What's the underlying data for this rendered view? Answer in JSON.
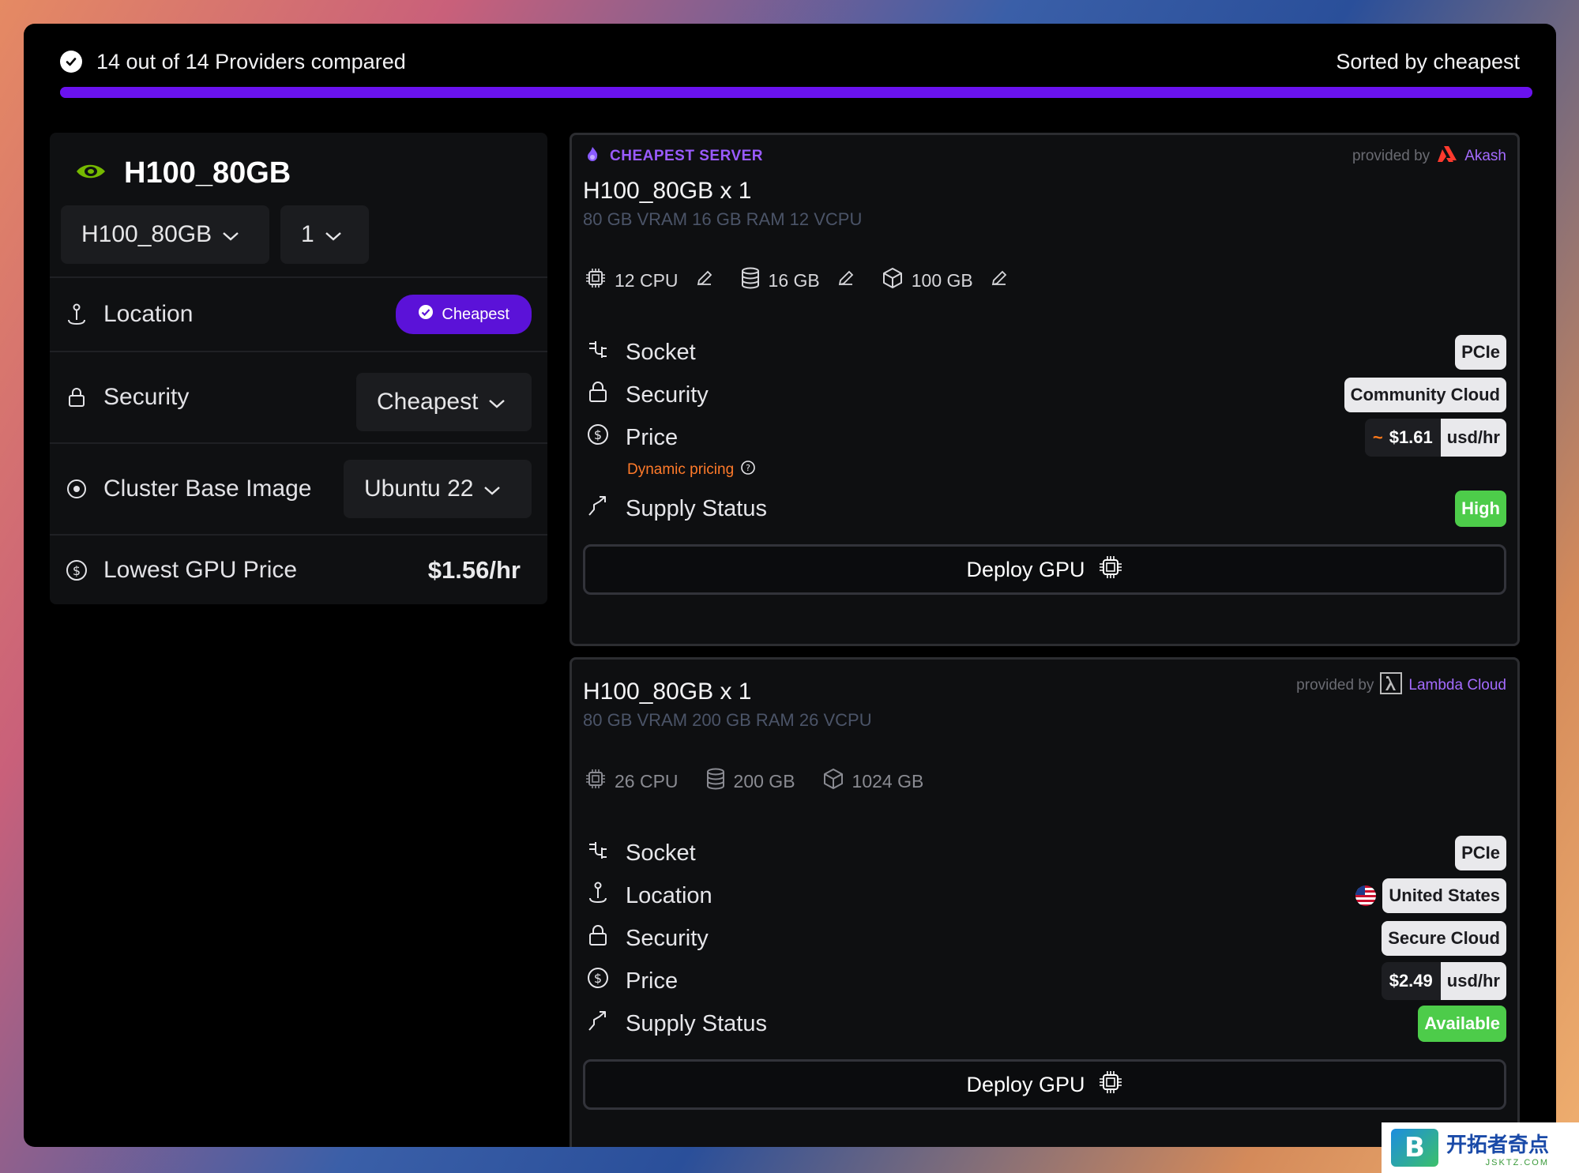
{
  "header": {
    "compared_text": "14 out of 14 Providers compared",
    "sorted_text": "Sorted by cheapest",
    "progress": 1.0
  },
  "left_panel": {
    "title": "H100_80GB",
    "gpu_select": "H100_80GB",
    "count_select": "1",
    "location_label": "Location",
    "location_badge": "Cheapest",
    "security_label": "Security",
    "security_select": "Cheapest",
    "image_label": "Cluster Base Image",
    "image_select": "Ubuntu 22",
    "lowest_label": "Lowest GPU Price",
    "lowest_value": "$1.56/hr"
  },
  "cards": [
    {
      "tag": "CHEAPEST SERVER",
      "provided_by": "provided by",
      "provider": "Akash",
      "title": "H100_80GB x 1",
      "subtitle": "80 GB VRAM 16 GB RAM 12 VCPU",
      "cpu": "12 CPU",
      "ram": "16 GB",
      "disk": "100 GB",
      "socket_label": "Socket",
      "socket_value": "PCIe",
      "security_label": "Security",
      "security_value": "Community Cloud",
      "price_label": "Price",
      "price_tilde": "~",
      "price_value": "$1.61",
      "price_unit": "usd/hr",
      "dynamic_text": "Dynamic pricing",
      "supply_label": "Supply Status",
      "supply_value": "High",
      "deploy_label": "Deploy GPU"
    },
    {
      "provided_by": "provided by",
      "provider": "Lambda Cloud",
      "title": "H100_80GB x 1",
      "subtitle": "80 GB VRAM 200 GB RAM 26 VCPU",
      "cpu": "26 CPU",
      "ram": "200 GB",
      "disk": "1024 GB",
      "socket_label": "Socket",
      "socket_value": "PCIe",
      "location_label": "Location",
      "location_value": "United States",
      "security_label": "Security",
      "security_value": "Secure Cloud",
      "price_label": "Price",
      "price_value": "$2.49",
      "price_unit": "usd/hr",
      "supply_label": "Supply Status",
      "supply_value": "Available",
      "deploy_label": "Deploy GPU"
    }
  ],
  "watermark": {
    "logo_letter": "B",
    "cn_text": "开拓者奇点",
    "en_text": "JSKTZ.COM"
  },
  "colors": {
    "accent_purple": "#6a12ee",
    "badge_purple": "#5b12d8",
    "green": "#4dcc4a",
    "orange": "#ff7a1a"
  }
}
